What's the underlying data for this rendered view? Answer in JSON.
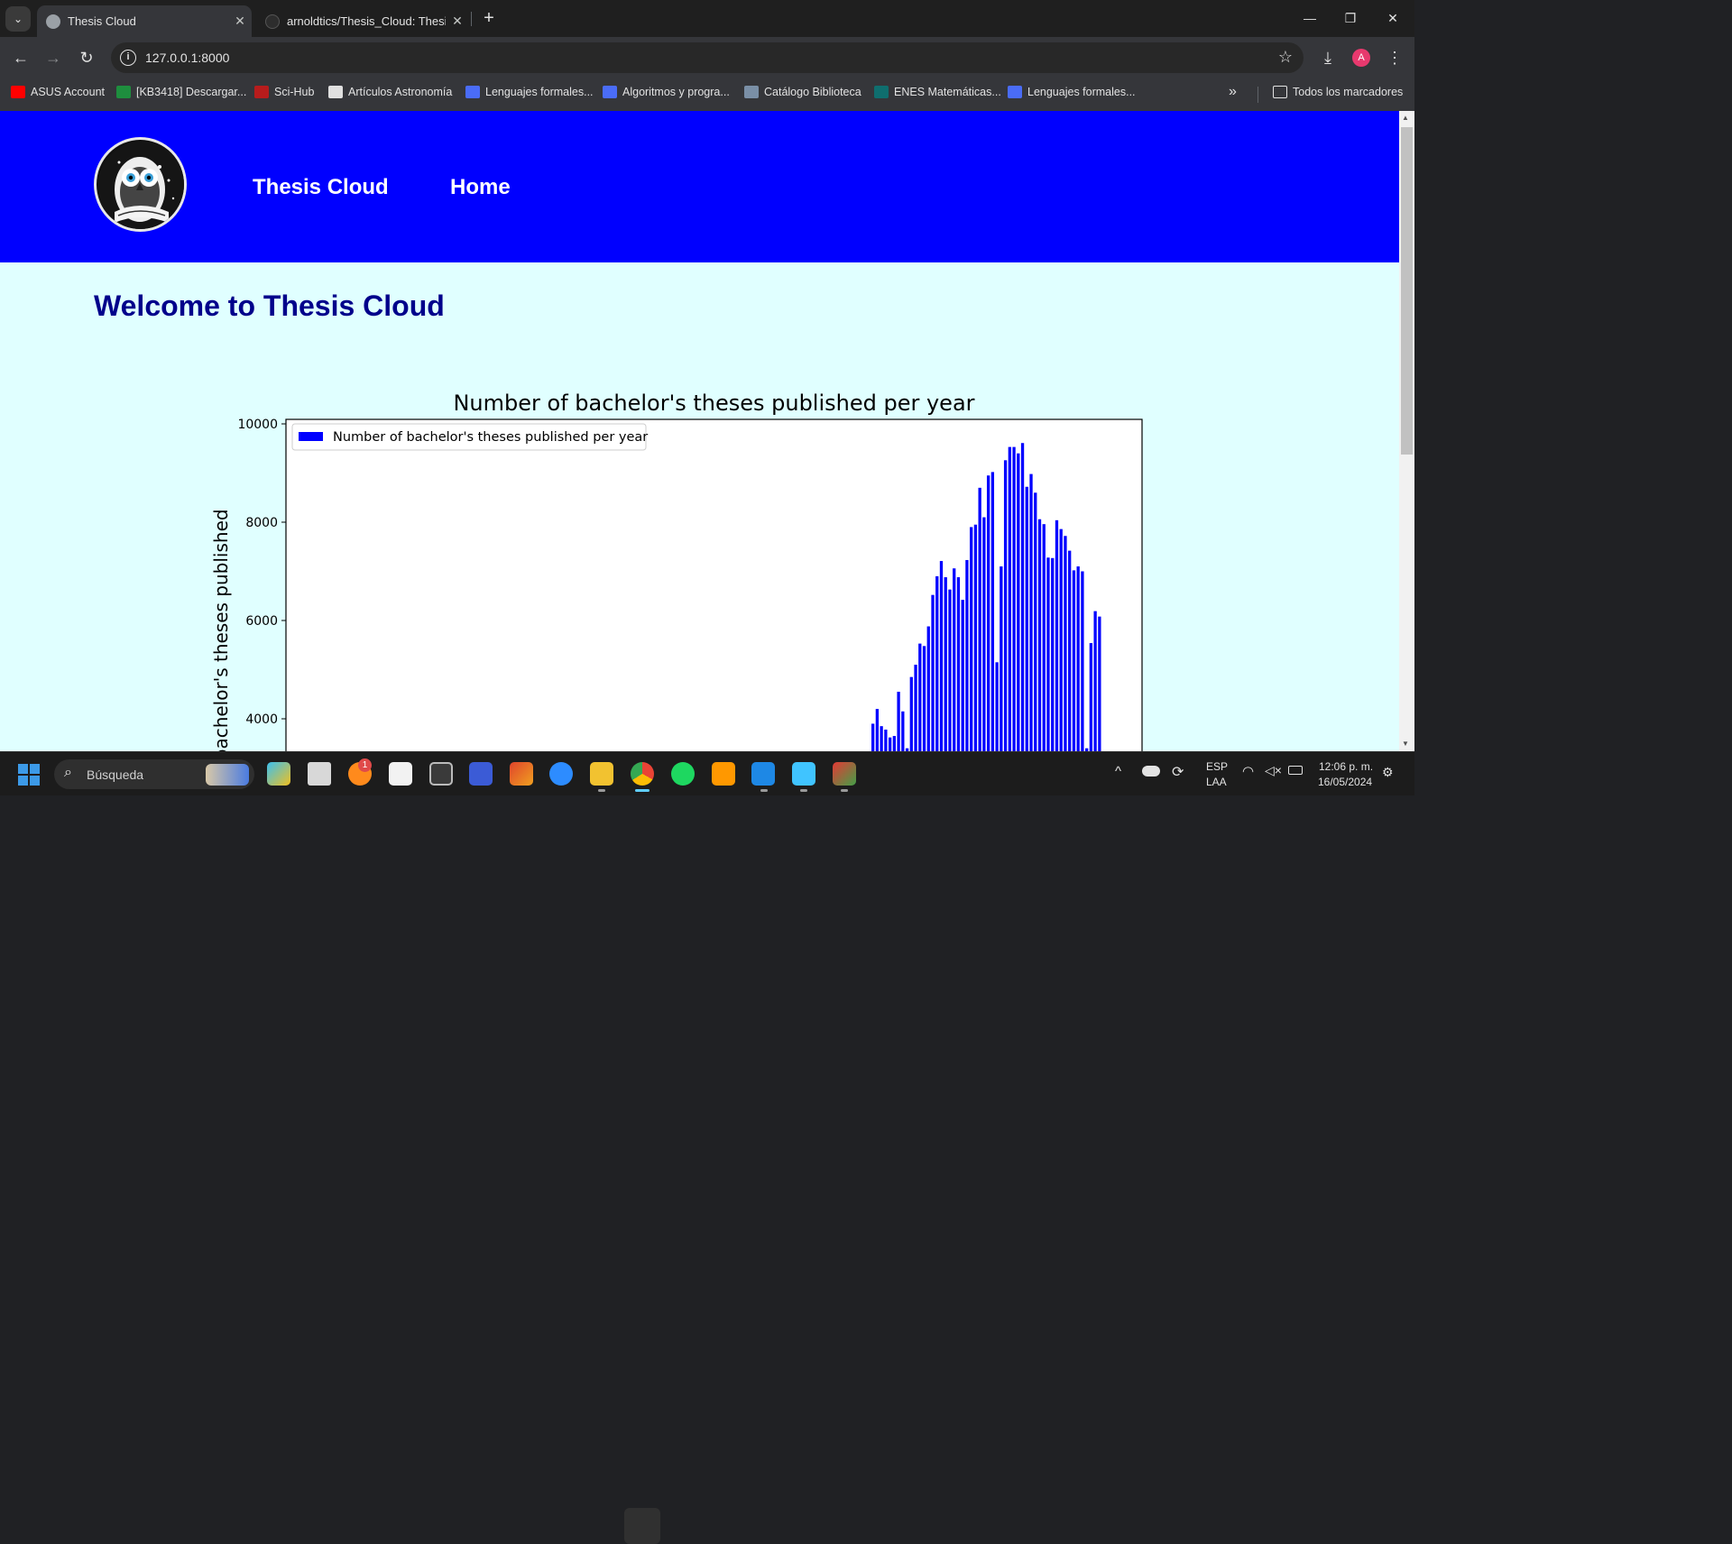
{
  "browser": {
    "tabs": [
      {
        "title": "Thesis Cloud",
        "active": true
      },
      {
        "title": "arnoldtics/Thesis_Cloud: Thesis",
        "active": false
      }
    ],
    "url": "127.0.0.1:8000",
    "profile_initial": "A",
    "bookmarks": [
      {
        "label": "ASUS Account",
        "color": "#ff0000"
      },
      {
        "label": "[KB3418] Descargar...",
        "color": "#1e8e3e"
      },
      {
        "label": "Sci-Hub",
        "color": "#b71c1c"
      },
      {
        "label": "Artículos Astronomía",
        "color": "#e0e0e0"
      },
      {
        "label": "Lenguajes formales...",
        "color": "#4a6cf7"
      },
      {
        "label": "Algoritmos y progra...",
        "color": "#4a6cf7"
      },
      {
        "label": "Catálogo Biblioteca",
        "color": "#7a8fa6"
      },
      {
        "label": "ENES Matemáticas...",
        "color": "#0f6e6e"
      },
      {
        "label": "Lenguajes formales...",
        "color": "#4a6cf7"
      }
    ],
    "all_bookmarks": "Todos los marcadores"
  },
  "site": {
    "header_bg": "#0000ff",
    "nav": [
      "Thesis Cloud",
      "Home"
    ],
    "heading": "Welcome to Thesis Cloud",
    "background": "#e0ffff"
  },
  "chart_data": {
    "type": "bar",
    "title": "Number of bachelor's theses published per year",
    "ylabel": "Number of bachelor's theses published",
    "legend": [
      "Number of bachelor's theses published per year"
    ],
    "legend_position": "top-left",
    "color": "#0000ff",
    "yticks": [
      4000,
      6000,
      8000,
      10000
    ],
    "ylim_visible": [
      3350,
      10100
    ],
    "values": [
      3900,
      4200,
      3850,
      3780,
      3620,
      3650,
      4550,
      4150,
      3400,
      4850,
      5100,
      5530,
      5480,
      5880,
      6520,
      6900,
      7210,
      6880,
      6630,
      7060,
      6880,
      6420,
      7230,
      7900,
      7950,
      8700,
      8100,
      8950,
      9020,
      5150,
      7100,
      9260,
      9530,
      9530,
      9400,
      9610,
      8720,
      8980,
      8600,
      8060,
      7960,
      7280,
      7270,
      8040,
      7860,
      7720,
      7420,
      7020,
      7100,
      7000,
      3400,
      5540,
      6190,
      6080
    ]
  },
  "taskbar": {
    "search_placeholder": "Búsqueda",
    "notification_count": "1",
    "lang_top": "ESP",
    "lang_bottom": "LAA",
    "time": "12:06 p. m.",
    "date": "16/05/2024"
  }
}
